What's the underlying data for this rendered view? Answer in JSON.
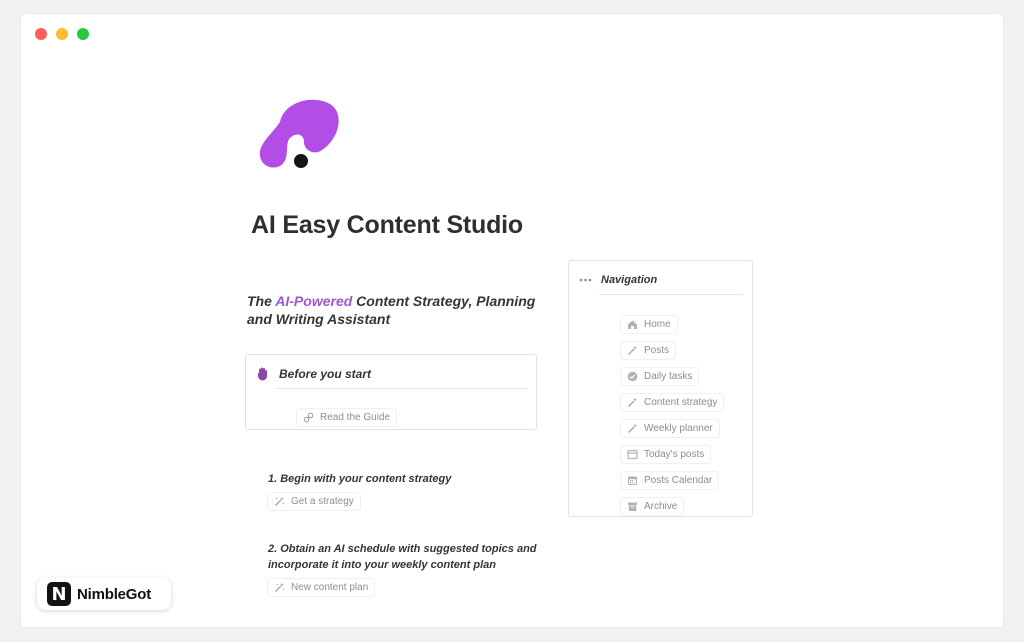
{
  "window": {
    "controls": [
      "close",
      "minimize",
      "maximize"
    ]
  },
  "page": {
    "title": "AI Easy Content Studio",
    "logo_icon": "purple-blob-logo-icon",
    "subtitle_prefix": "The ",
    "subtitle_accent": "AI-Powered",
    "subtitle_rest": " Content Strategy, Planning and Writing Assistant",
    "accent_color": "#9b59d0"
  },
  "before_start": {
    "icon": "raised-hand-icon",
    "title": "Before you start",
    "link_icon": "link-icon",
    "link_label": "Read the Guide"
  },
  "steps": [
    {
      "text": "1. Begin with your content strategy",
      "button_icon": "magic-wand-icon",
      "button_label": "Get a strategy"
    },
    {
      "text": "2. Obtain an AI schedule with suggested topics and incorporate it into your weekly content plan",
      "button_icon": "magic-wand-icon",
      "button_label": "New content plan"
    }
  ],
  "navigation": {
    "title": "Navigation",
    "menu_icon": "ellipsis-icon",
    "items": [
      {
        "label": "Home",
        "icon": "home-icon"
      },
      {
        "label": "Posts",
        "icon": "magic-wand-icon"
      },
      {
        "label": "Daily tasks",
        "icon": "check-circle-icon"
      },
      {
        "label": "Content strategy",
        "icon": "magic-wand-icon"
      },
      {
        "label": "Weekly planner",
        "icon": "magic-wand-icon"
      },
      {
        "label": "Today's posts",
        "icon": "window-icon"
      },
      {
        "label": "Posts Calendar",
        "icon": "calendar-icon"
      },
      {
        "label": "Archive",
        "icon": "archive-icon"
      }
    ]
  },
  "brand": {
    "mark": "N",
    "name": "NimbleGot"
  }
}
